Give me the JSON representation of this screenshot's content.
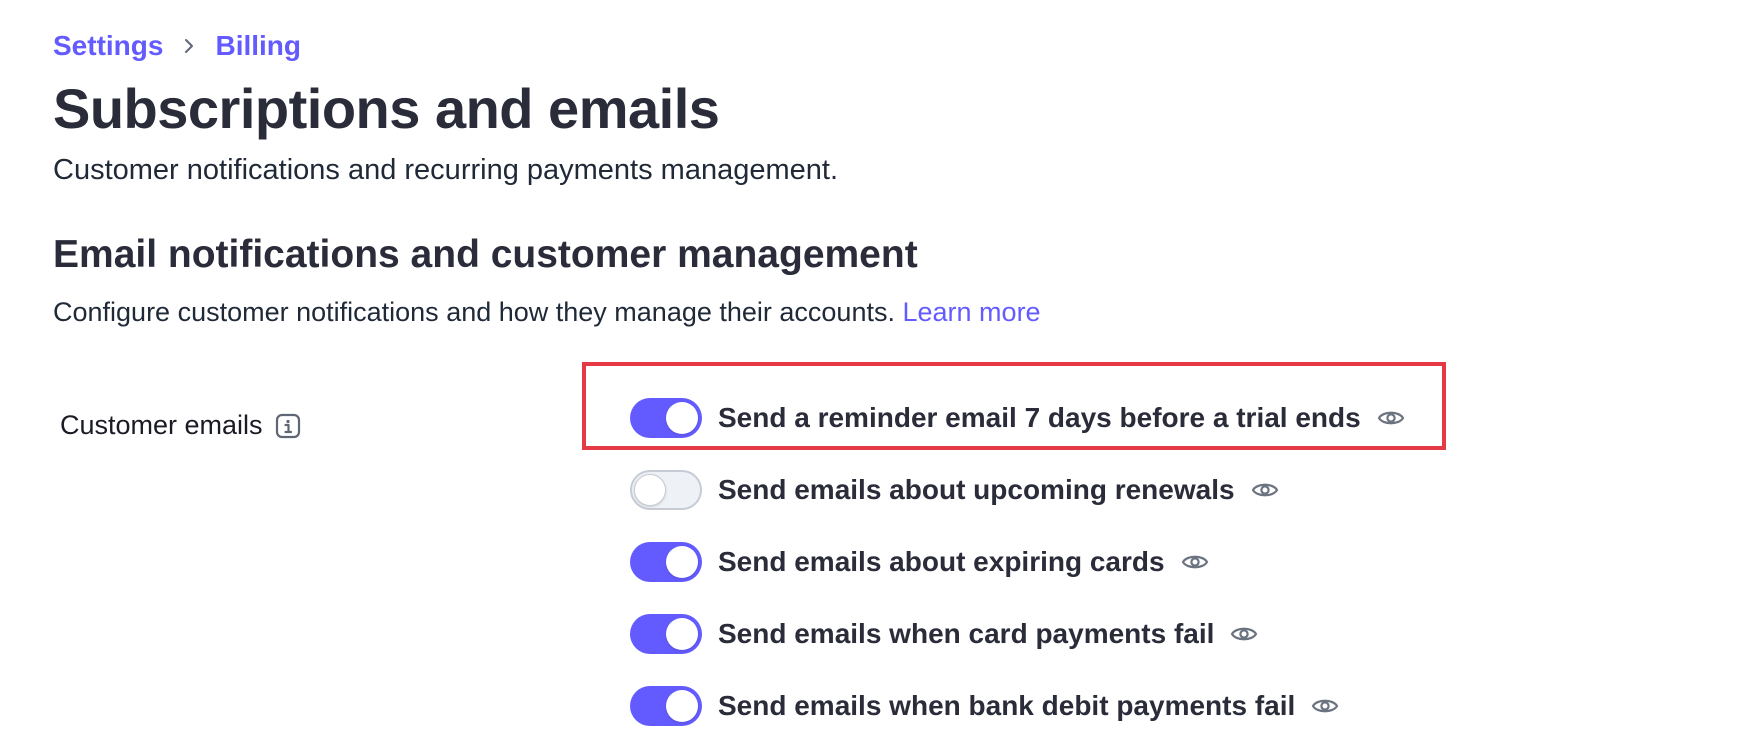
{
  "breadcrumb": {
    "items": [
      "Settings",
      "Billing"
    ]
  },
  "page": {
    "title": "Subscriptions and emails",
    "subtitle": "Customer notifications and recurring payments management."
  },
  "section": {
    "title": "Email notifications and customer management",
    "description": "Configure customer notifications and how they manage their accounts.",
    "learn_more": "Learn more"
  },
  "customer_emails": {
    "label": "Customer emails",
    "options": [
      {
        "label": "Send a reminder email 7 days before a trial ends",
        "enabled": true
      },
      {
        "label": "Send emails about upcoming renewals",
        "enabled": false
      },
      {
        "label": "Send emails about expiring cards",
        "enabled": true
      },
      {
        "label": "Send emails when card payments fail",
        "enabled": true
      },
      {
        "label": "Send emails when bank debit payments fail",
        "enabled": true
      }
    ]
  },
  "icons": {
    "breadcrumb_separator": "chevron-right-icon",
    "info": "info-icon",
    "preview": "eye-icon"
  },
  "colors": {
    "accent": "#635bff",
    "highlight_border": "#e63946",
    "toggle_off": "#eef1f6"
  }
}
